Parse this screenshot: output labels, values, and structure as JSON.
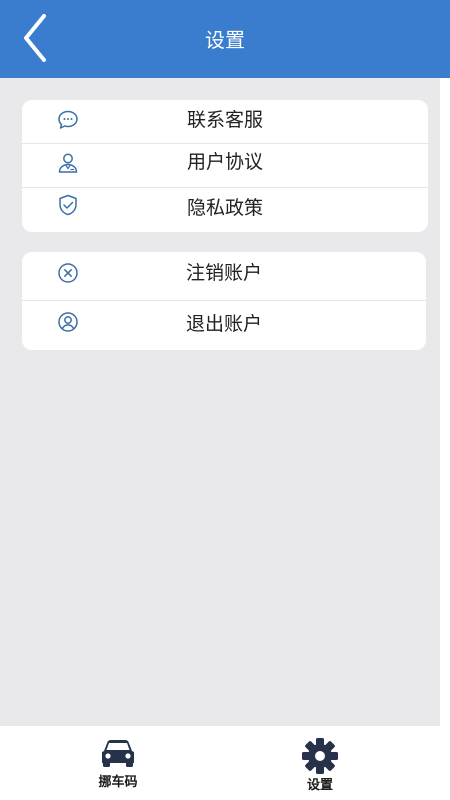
{
  "header": {
    "title": "设置",
    "back_icon": "chevron-left-icon"
  },
  "menu_group_1": [
    {
      "label": "联系客服",
      "icon": "chat-bubble-icon"
    },
    {
      "label": "用户协议",
      "icon": "user-agreement-icon"
    },
    {
      "label": "隐私政策",
      "icon": "shield-check-icon"
    }
  ],
  "menu_group_2": [
    {
      "label": "注销账户",
      "icon": "circle-x-icon"
    },
    {
      "label": "退出账户",
      "icon": "user-circle-icon"
    }
  ],
  "tabbar": {
    "tabs": [
      {
        "label": "挪车码",
        "icon": "car-icon"
      },
      {
        "label": "设置",
        "icon": "gear-icon"
      }
    ]
  },
  "colors": {
    "header": "#3a7dcf",
    "background": "#e9e9eb",
    "icon": "#3a6fa8"
  }
}
